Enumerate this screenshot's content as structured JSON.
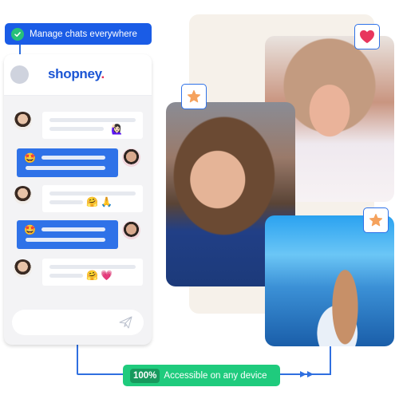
{
  "top_badge": {
    "icon": "check-circle-icon",
    "label": "Manage chats everywhere"
  },
  "chat_widget": {
    "brand": {
      "name": "shopney",
      "dot": "."
    },
    "messages": [
      {
        "direction": "incoming",
        "avatar": "woman-avatar",
        "emojis": [
          "🙋🏻‍♀️"
        ]
      },
      {
        "direction": "outgoing",
        "avatar": "man-avatar",
        "emojis": [
          "🤩"
        ]
      },
      {
        "direction": "incoming",
        "avatar": "woman-avatar",
        "emojis": [
          "🤗",
          "🙏"
        ]
      },
      {
        "direction": "outgoing",
        "avatar": "man-avatar",
        "emojis": [
          "🤩"
        ]
      },
      {
        "direction": "incoming",
        "avatar": "woman-avatar",
        "emojis": [
          "🤗",
          "💗"
        ]
      }
    ],
    "input": {
      "placeholder": "",
      "send_icon": "paper-plane-icon"
    }
  },
  "photos": [
    {
      "name": "woman-with-glasses-photo",
      "badge_icon": "star-icon"
    },
    {
      "name": "woman-in-hat-laughing-photo",
      "badge_icon": "heart-icon"
    },
    {
      "name": "woman-at-sea-photo",
      "badge_icon": "star-icon"
    }
  ],
  "bottom_badge": {
    "percent": "100%",
    "label": "Accessible on any device"
  },
  "colors": {
    "brand_blue": "#1a5ce6",
    "bubble_blue": "#2f72e8",
    "green": "#1fcb7d",
    "heart": "#e8365d",
    "star": "#f5a25d"
  }
}
